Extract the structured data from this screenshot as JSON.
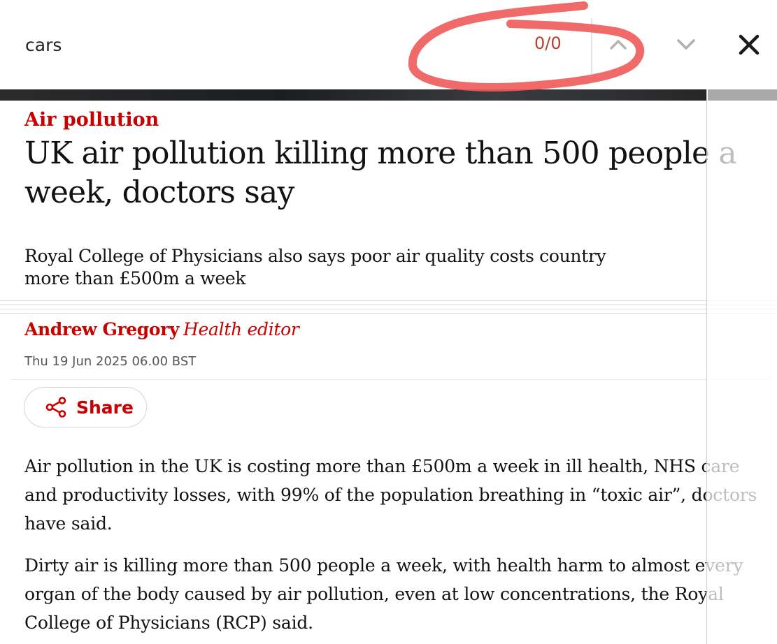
{
  "find_bar": {
    "query": "cars",
    "match_count": "0/0",
    "icons": {
      "previous": "chevron-up-icon",
      "next": "chevron-down-icon",
      "close": "close-icon"
    }
  },
  "article": {
    "kicker": "Air pollution",
    "headline": "UK air pollution killing more than 500 people a week, doctors say",
    "standfirst": "Royal College of Physicians also says poor air quality costs country more than £500m a week",
    "author": "Andrew Gregory",
    "author_role": "Health editor",
    "dateline": "Thu 19 Jun 2025 06.00 BST",
    "share_label": "Share",
    "paragraphs": [
      "Air pollution in the UK is costing more than £500m a week in ill health, NHS care and productivity losses, with 99% of the population breathing in “toxic air”, doctors have said.",
      "Dirty air is killing more than 500 people a week, with health harm to almost every organ of the body caused by air pollution, even at low concentrations, the Royal College of Physicians (RCP) said."
    ]
  },
  "colors": {
    "accent": "#c70000",
    "annotation": "#f05a5a",
    "text": "#121212"
  }
}
